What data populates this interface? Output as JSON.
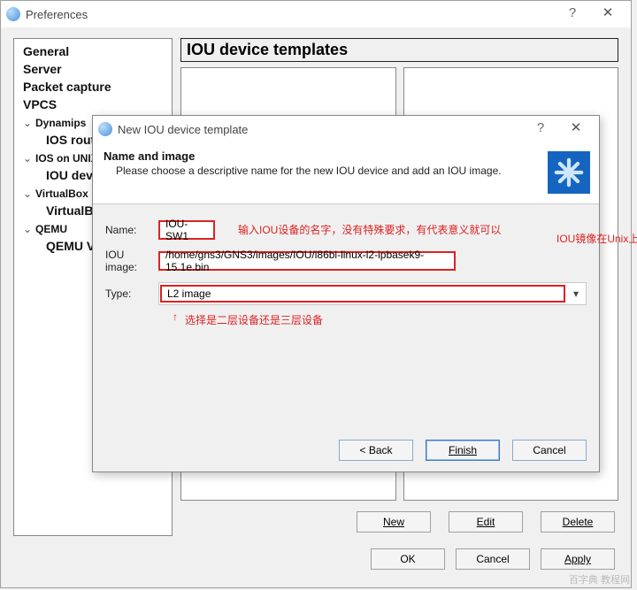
{
  "pref_window": {
    "title": "Preferences",
    "help_icon": "?",
    "close_icon": "✕"
  },
  "tree": {
    "general": "General",
    "server": "Server",
    "packet_capture": "Packet capture",
    "vpcs": "VPCS",
    "dynamips": "Dynamips",
    "ios_routers": "IOS routers",
    "ios_on_unix": "IOS on UNIX",
    "iou_devices": "IOU devices",
    "virtualbox": "VirtualBox",
    "virtualbox_vms": "VirtualBox VMs",
    "qemu": "QEMU",
    "qemu_vms": "QEMU VMs"
  },
  "content": {
    "title": "IOU device templates",
    "buttons": {
      "new": "New",
      "edit": "Edit",
      "delete": "Delete"
    }
  },
  "bottom": {
    "ok": "OK",
    "cancel": "Cancel",
    "apply": "Apply"
  },
  "dialog": {
    "titlebar": "New IOU device template",
    "help_icon": "?",
    "close_icon": "✕",
    "header_title": "Name and image",
    "header_sub": "Please choose a descriptive name for the new IOU device and add an IOU image.",
    "name_label": "Name:",
    "name_value": "IOU-SW1",
    "image_label": "IOU image:",
    "image_value": "/home/gns3/GNS3/images/IOU/i86bi-linux-l2-ipbasek9-15.1e.bin",
    "type_label": "Type:",
    "type_value": "L2 image",
    "annot_name": "输入IOU设备的名字，没有特殊要求，有代表意义就可以",
    "annot_image": "IOU镜像在Unix上的目录路径",
    "annot_type_arrow": "↑",
    "annot_type": "选择是二层设备还是三层设备",
    "back": "< Back",
    "finish": "Finish",
    "cancel": "Cancel"
  },
  "watermark": "百字典 教程网"
}
